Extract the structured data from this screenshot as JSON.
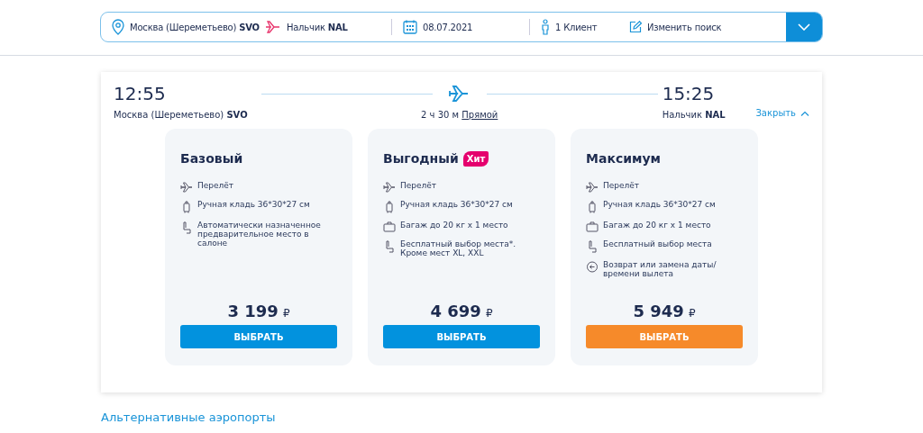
{
  "search_bar": {
    "route_from": "Москва (Шереметьево) **SVO**",
    "route_to": "Нальчик **NAL**",
    "date": "08.07.2021",
    "passengers": "1 Клиент",
    "edit": "Изменить поиск"
  },
  "flight": {
    "departure_time": "12:55",
    "arrival_time": "15:25",
    "departure_airport": "Москва (Шереметьево) **SVO**",
    "arrival_airport": "Нальчик **NAL**",
    "duration": "2 ч 30 м",
    "type": "Прямой",
    "close": "Закрыть"
  },
  "fares": [
    {
      "name": "Базовый",
      "price": "3 199",
      "currency": "₽",
      "button": "ВЫБРАТЬ",
      "color": "#0292de",
      "features": [
        {
          "kind": "flight",
          "text": "Перелёт"
        },
        {
          "kind": "hand",
          "text": "Ручная кладь 36*30*27 см"
        },
        {
          "kind": "seat",
          "text": "Автоматически назначенное предварительное место в салоне"
        }
      ]
    },
    {
      "name": "Выгодный",
      "badge": "Хит",
      "price": "4 699",
      "currency": "₽",
      "button": "ВЫБРАТЬ",
      "color": "#0292de",
      "features": [
        {
          "kind": "flight",
          "text": "Перелёт"
        },
        {
          "kind": "hand",
          "text": "Ручная кладь 36*30*27 см"
        },
        {
          "kind": "bag",
          "text": "Багаж до 20 кг x 1 место"
        },
        {
          "kind": "seat",
          "text": "Бесплатный выбор места*. Кроме мест XL, XXL"
        }
      ]
    },
    {
      "name": "Максимум",
      "price": "5 949",
      "currency": "₽",
      "button": "ВЫБРАТЬ",
      "color": "#f68a2a",
      "features": [
        {
          "kind": "flight",
          "text": "Перелёт"
        },
        {
          "kind": "hand",
          "text": "Ручная кладь 36*30*27 см"
        },
        {
          "kind": "bag",
          "text": "Багаж до 20 кг x 1 место"
        },
        {
          "kind": "seat",
          "text": "Бесплатный выбор места"
        },
        {
          "kind": "refund",
          "text": "Возврат или замена даты/ времени вылета"
        }
      ]
    }
  ],
  "alternative_link": "Альтернативные аэропорты"
}
